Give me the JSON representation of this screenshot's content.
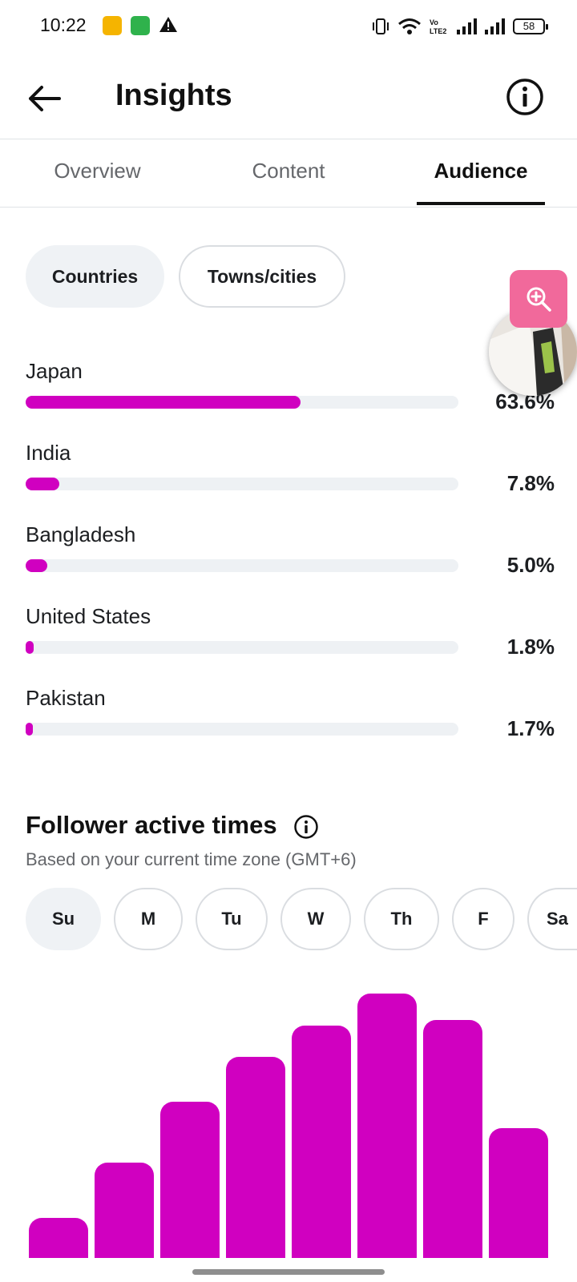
{
  "status_bar": {
    "time": "10:22",
    "battery": "58",
    "icons": [
      "key-notification-icon",
      "android-notification-icon",
      "warning-icon",
      "vibrate-icon",
      "wifi-icon",
      "volte-icon",
      "signal-icon",
      "signal-icon",
      "battery-icon"
    ]
  },
  "header": {
    "title": "Insights",
    "back_icon": "arrow-left-icon",
    "info_icon": "info-icon"
  },
  "tabs": [
    {
      "label": "Overview",
      "active": false
    },
    {
      "label": "Content",
      "active": false
    },
    {
      "label": "Audience",
      "active": true
    }
  ],
  "location_filters": [
    {
      "label": "Countries",
      "selected": true
    },
    {
      "label": "Towns/cities",
      "selected": false
    }
  ],
  "countries": [
    {
      "name": "Japan",
      "percent_label": "63.6%",
      "percent": 63.6
    },
    {
      "name": "India",
      "percent_label": "7.8%",
      "percent": 7.8
    },
    {
      "name": "Bangladesh",
      "percent_label": "5.0%",
      "percent": 5.0
    },
    {
      "name": "United States",
      "percent_label": "1.8%",
      "percent": 1.8
    },
    {
      "name": "Pakistan",
      "percent_label": "1.7%",
      "percent": 1.7
    }
  ],
  "floating_widget": {
    "zoom_icon": "zoom-in-icon",
    "accent": "#f1699b"
  },
  "active_times": {
    "title": "Follower active times",
    "subtitle": "Based on your current time zone (GMT+6)",
    "days": [
      {
        "label": "Su",
        "selected": true
      },
      {
        "label": "M",
        "selected": false
      },
      {
        "label": "Tu",
        "selected": false
      },
      {
        "label": "W",
        "selected": false
      },
      {
        "label": "Th",
        "selected": false
      },
      {
        "label": "F",
        "selected": false
      },
      {
        "label": "Sa",
        "selected": false
      }
    ]
  },
  "chart_data": {
    "type": "bar",
    "title": "Follower active times",
    "values": [
      15,
      36,
      59,
      76,
      88,
      100,
      90,
      49
    ],
    "ylim": [
      0,
      100
    ],
    "color": "#d000c0"
  },
  "colors": {
    "accent_bar": "#d000c0",
    "track": "#eef1f4",
    "chip_selected": "#eff2f5"
  }
}
